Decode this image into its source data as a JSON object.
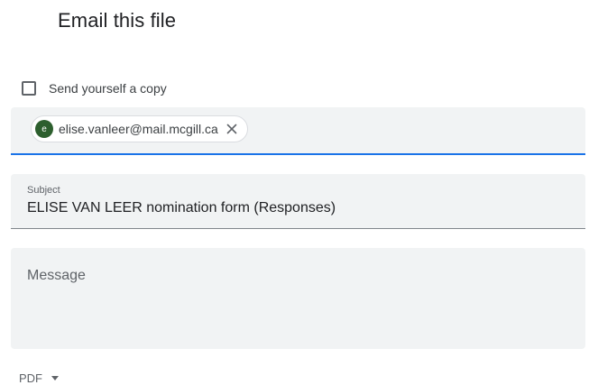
{
  "dialog": {
    "title": "Email this file"
  },
  "send_copy": {
    "label": "Send yourself a copy",
    "checked": false
  },
  "recipients": [
    {
      "initial": "e",
      "email": "elise.vanleer@mail.mcgill.ca",
      "avatar_color": "#2d5f2e",
      "remove_icon": "close-icon"
    }
  ],
  "subject": {
    "label": "Subject",
    "value": "ELISE VAN LEER nomination form (Responses)"
  },
  "message": {
    "placeholder": "Message"
  },
  "attachment_format": {
    "selected": "PDF",
    "icon": "caret-down-icon"
  },
  "colors": {
    "accent": "#1a73e8",
    "field_bg": "#f1f3f4"
  }
}
